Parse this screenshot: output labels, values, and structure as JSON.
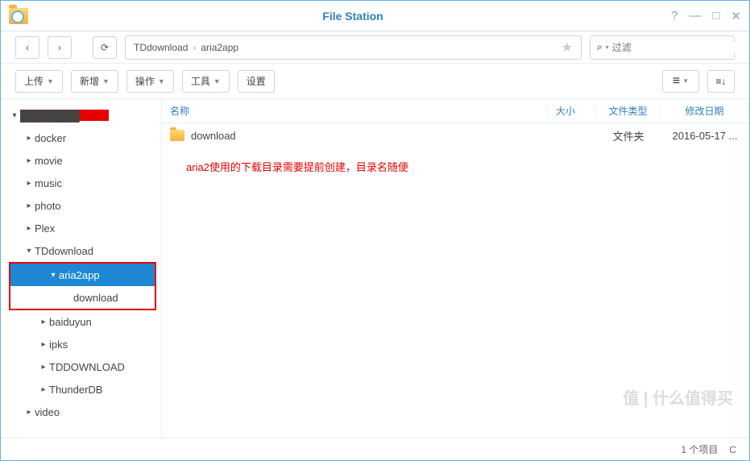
{
  "title": "File Station",
  "nav": {
    "back": "‹",
    "forward": "›",
    "refresh": "⟳"
  },
  "breadcrumb": [
    "TDdownload",
    "aria2app"
  ],
  "filter": {
    "placeholder": "过滤"
  },
  "toolbar": {
    "upload": "上传",
    "create": "新增",
    "action": "操作",
    "tool": "工具",
    "settings": "设置"
  },
  "columns": {
    "name": "名称",
    "size": "大小",
    "type": "文件类型",
    "date": "修改日期"
  },
  "files": [
    {
      "name": "download",
      "size": "",
      "type": "文件夹",
      "date": "2016-05-17 ..."
    }
  ],
  "annotation": "aria2使用的下载目录需要提前创建，目录名随便",
  "tree": {
    "redacted": "████████",
    "items": [
      {
        "label": "docker",
        "indent": 1,
        "arrow": "▸"
      },
      {
        "label": "movie",
        "indent": 1,
        "arrow": "▸"
      },
      {
        "label": "music",
        "indent": 1,
        "arrow": "▸"
      },
      {
        "label": "photo",
        "indent": 1,
        "arrow": "▸"
      },
      {
        "label": "Plex",
        "indent": 1,
        "arrow": "▸"
      },
      {
        "label": "TDdownload",
        "indent": 1,
        "arrow": "▾",
        "expanded": true
      },
      {
        "label": "aria2app",
        "indent": 2,
        "arrow": "▾",
        "selected": true,
        "redbox_start": true
      },
      {
        "label": "download",
        "indent": 3,
        "arrow": "",
        "redbox_end": true
      },
      {
        "label": "baiduyun",
        "indent": 2,
        "arrow": "▸"
      },
      {
        "label": "ipks",
        "indent": 2,
        "arrow": "▸"
      },
      {
        "label": "TDDOWNLOAD",
        "indent": 2,
        "arrow": "▸"
      },
      {
        "label": "ThunderDB",
        "indent": 2,
        "arrow": "▸"
      },
      {
        "label": "video",
        "indent": 1,
        "arrow": "▸"
      }
    ]
  },
  "status": {
    "count_template": "1 个项目",
    "refresh": "C"
  },
  "watermark": "值 | 什么值得买"
}
